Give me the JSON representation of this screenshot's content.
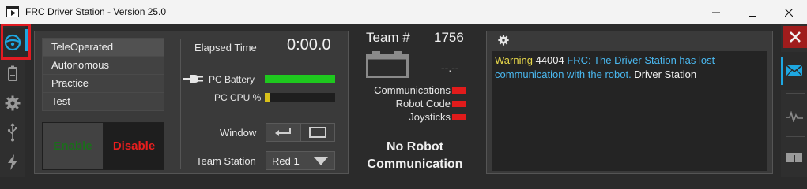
{
  "window": {
    "title": "FRC Driver Station - Version 25.0"
  },
  "left_rail": {
    "items": [
      {
        "icon": "steering-wheel-icon",
        "selected": true
      },
      {
        "icon": "battery-icon"
      },
      {
        "icon": "gear-icon"
      },
      {
        "icon": "usb-icon"
      },
      {
        "icon": "lightning-icon"
      }
    ]
  },
  "modes": {
    "items": [
      "TeleOperated",
      "Autonomous",
      "Practice",
      "Test"
    ],
    "selected": "TeleOperated"
  },
  "controls": {
    "enable_label": "Enable",
    "disable_label": "Disable",
    "enable_color": "#1b6e1b",
    "disable_color": "#e81e1e"
  },
  "status": {
    "elapsed_label": "Elapsed Time",
    "elapsed_value": "0:00.0",
    "pc_battery_label": "PC Battery",
    "pc_battery_level": 1.0,
    "pc_cpu_label": "PC CPU %",
    "pc_cpu_level": 0.08,
    "window_label": "Window",
    "team_station_label": "Team Station",
    "team_station_value": "Red 1"
  },
  "robot": {
    "team_label": "Team #",
    "team_number": "1756",
    "voltage": "--.--",
    "indicators": [
      {
        "label": "Communications",
        "color": "#e11b1b"
      },
      {
        "label": "Robot Code",
        "color": "#e11b1b"
      },
      {
        "label": "Joysticks",
        "color": "#e11b1b"
      }
    ],
    "status_line1": "No Robot",
    "status_line2": "Communication"
  },
  "messages": {
    "warning_label": "Warning",
    "code": "44004",
    "text": "FRC: The Driver Station has lost communication with the robot.",
    "source": "Driver Station"
  },
  "right_rail": {
    "items": [
      {
        "icon": "close-icon"
      },
      {
        "icon": "envelope-icon",
        "selected": true
      },
      {
        "icon": "chart-icon"
      },
      {
        "icon": "split-view-icon"
      }
    ]
  }
}
